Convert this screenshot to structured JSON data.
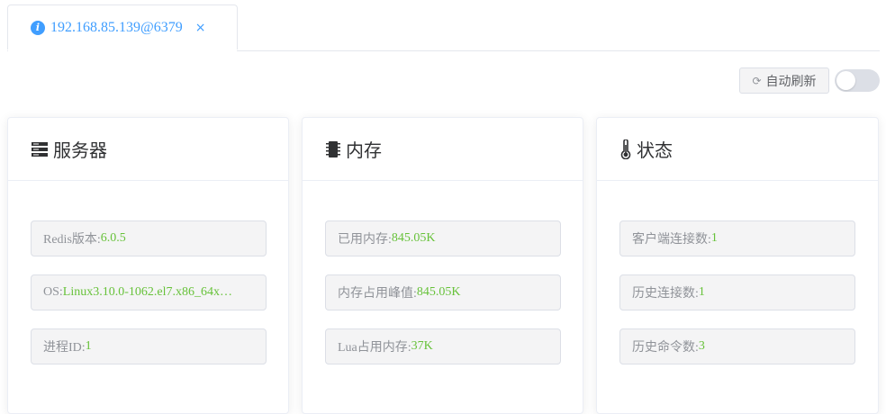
{
  "tab": {
    "label": "192.168.85.139@6379",
    "close": "×"
  },
  "toolbar": {
    "refresh_label": "自动刷新",
    "refresh_icon": "refresh-icon",
    "auto_refresh_on": false
  },
  "colors": {
    "accent": "#409eff",
    "value": "#67c23a"
  },
  "cards": [
    {
      "title": "服务器",
      "icon": "server-icon",
      "items": [
        {
          "label": "Redis版本: ",
          "value": "6.0.5"
        },
        {
          "label": "OS: ",
          "value": "Linux3.10.0-1062.el7.x86_64x…"
        },
        {
          "label": "进程ID: ",
          "value": "1"
        }
      ]
    },
    {
      "title": "内存",
      "icon": "memory-chip-icon",
      "items": [
        {
          "label": "已用内存: ",
          "value": "845.05K"
        },
        {
          "label": "内存占用峰值: ",
          "value": "845.05K"
        },
        {
          "label": "Lua占用内存: ",
          "value": "37K"
        }
      ]
    },
    {
      "title": "状态",
      "icon": "thermometer-icon",
      "items": [
        {
          "label": "客户端连接数: ",
          "value": "1"
        },
        {
          "label": "历史连接数: ",
          "value": "1"
        },
        {
          "label": "历史命令数: ",
          "value": "3"
        }
      ]
    }
  ]
}
